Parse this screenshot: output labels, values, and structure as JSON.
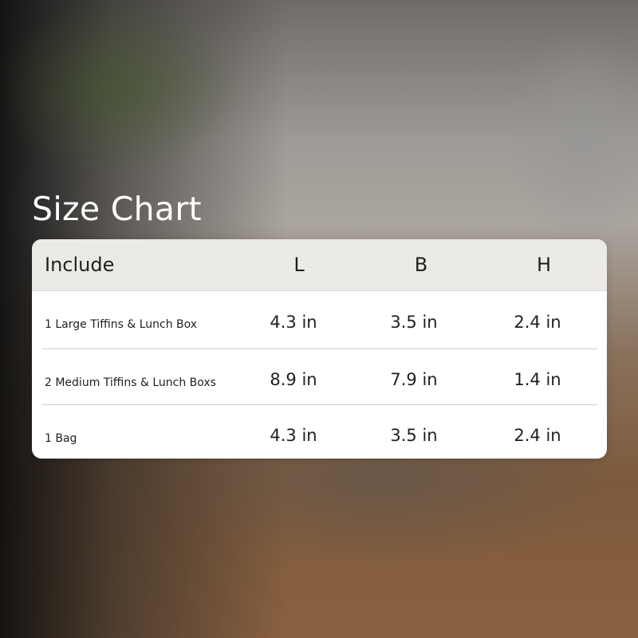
{
  "title": "Size Chart",
  "table": {
    "headers": [
      "Include",
      "L",
      "B",
      "H"
    ],
    "rows": [
      [
        "1 Large Tiffins & Lunch Box",
        "4.3 in",
        "3.5 in",
        "2.4 in"
      ],
      [
        "2 Medium Tiffins & Lunch Boxs",
        "8.9 in",
        "7.9 in",
        "1.4 in"
      ],
      [
        "1 Bag",
        "4.3 in",
        "3.5 in",
        "2.4 in"
      ]
    ]
  },
  "colors": {
    "header_bg": "#eceae6",
    "card_bg": "#ffffff",
    "text": "#1f1f1f",
    "title_text": "#ffffff"
  }
}
